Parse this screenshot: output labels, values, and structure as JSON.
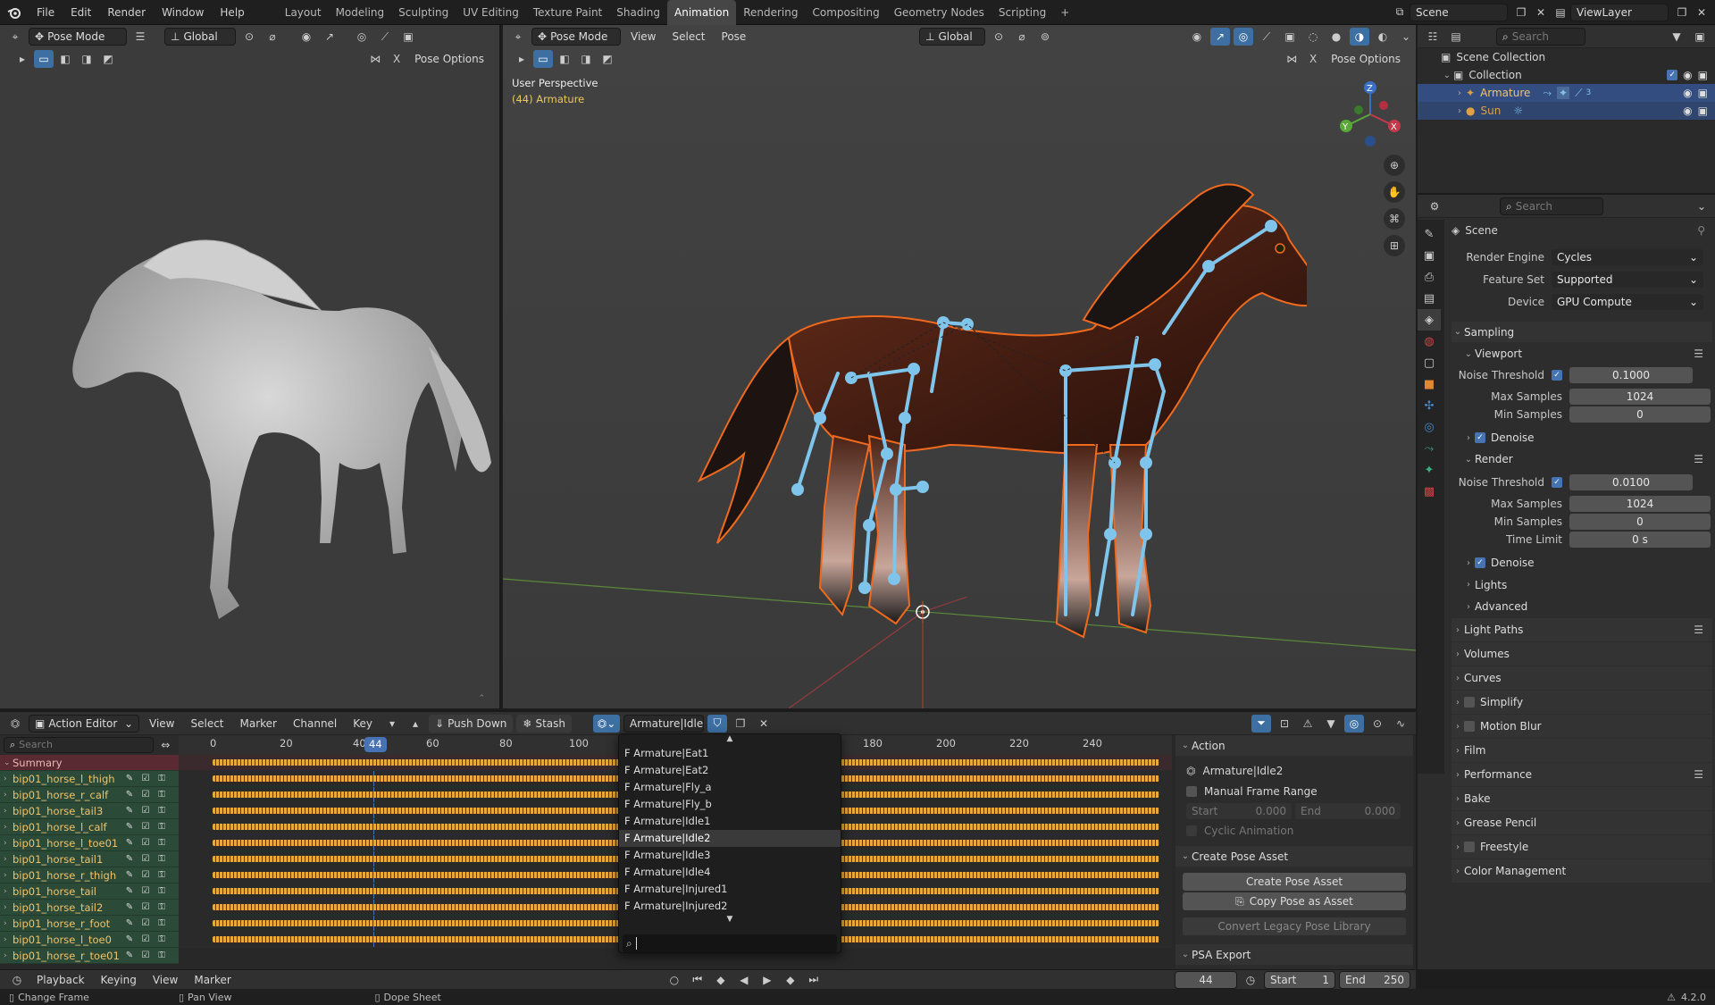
{
  "topbar": {
    "menus": [
      "File",
      "Edit",
      "Render",
      "Window",
      "Help"
    ],
    "workspaces": [
      "Layout",
      "Modeling",
      "Sculpting",
      "UV Editing",
      "Texture Paint",
      "Shading",
      "Animation",
      "Rendering",
      "Compositing",
      "Geometry Nodes",
      "Scripting"
    ],
    "active_workspace": "Animation",
    "scene": "Scene",
    "view_layer": "ViewLayer"
  },
  "left_viewport": {
    "mode": "Pose Mode",
    "transform": "Global",
    "pose_options": "Pose Options"
  },
  "main_viewport": {
    "mode": "Pose Mode",
    "menus": [
      "View",
      "Select",
      "Pose"
    ],
    "transform": "Global",
    "pose_options": "Pose Options",
    "overlay_title": "User Perspective",
    "overlay_object": "(44) Armature",
    "gizmo": {
      "z": "Z",
      "y": "Y",
      "x": "X"
    }
  },
  "outliner": {
    "search_placeholder": "Search",
    "items": [
      {
        "label": "Scene Collection"
      },
      {
        "label": "Collection"
      },
      {
        "label": "Armature",
        "extra": "3"
      },
      {
        "label": "Sun"
      }
    ]
  },
  "properties": {
    "search_placeholder": "Search",
    "title": "Scene",
    "render_engine_label": "Render Engine",
    "render_engine": "Cycles",
    "feature_set_label": "Feature Set",
    "feature_set": "Supported",
    "device_label": "Device",
    "device": "GPU Compute",
    "sampling": "Sampling",
    "viewport": "Viewport",
    "noise_threshold_label": "Noise Threshold",
    "viewport_noise_threshold": "0.1000",
    "max_samples_label": "Max Samples",
    "viewport_max_samples": "1024",
    "min_samples_label": "Min Samples",
    "viewport_min_samples": "0",
    "denoise": "Denoise",
    "render": "Render",
    "render_noise_threshold": "0.0100",
    "render_max_samples": "1024",
    "render_min_samples": "0",
    "time_limit_label": "Time Limit",
    "time_limit": "0 s",
    "lights": "Lights",
    "advanced": "Advanced",
    "sections": [
      "Light Paths",
      "Volumes",
      "Curves",
      "Simplify",
      "Motion Blur",
      "Film",
      "Performance",
      "Bake",
      "Grease Pencil",
      "Freestyle",
      "Color Management"
    ]
  },
  "action_editor": {
    "mode": "Action Editor",
    "menus": [
      "View",
      "Select",
      "Marker",
      "Channel",
      "Key"
    ],
    "push_down": "Push Down",
    "stash": "Stash",
    "action_name": "Armature|Idle2",
    "search_placeholder": "Search",
    "summary": "Summary",
    "current_frame": "44",
    "ticks_left": [
      "0",
      "20",
      "40",
      "60",
      "80",
      "100"
    ],
    "ticks_right": [
      "180",
      "200",
      "220",
      "240"
    ],
    "channels": [
      "bip01_horse_l_thigh",
      "bip01_horse_r_calf",
      "bip01_horse_tail3",
      "bip01_horse_l_calf",
      "bip01_horse_l_toe01",
      "bip01_horse_tail1",
      "bip01_horse_r_thigh",
      "bip01_horse_tail",
      "bip01_horse_tail2",
      "bip01_horse_r_foot",
      "bip01_horse_l_toe0",
      "bip01_horse_r_toe01"
    ],
    "dropdown_items": [
      "Armature|Eat1",
      "Armature|Eat2",
      "Armature|Fly_a",
      "Armature|Fly_b",
      "Armature|Idle1",
      "Armature|Idle2",
      "Armature|Idle3",
      "Armature|Idle4",
      "Armature|Injured1",
      "Armature|Injured2"
    ],
    "dropdown_selected": "Armature|Idle2"
  },
  "sidebar": {
    "action_header": "Action",
    "action_name": "Armature|Idle2",
    "manual_frame_range": "Manual Frame Range",
    "start_label": "Start",
    "start_value": "0.000",
    "end_label": "End",
    "end_value": "0.000",
    "cyclic": "Cyclic Animation",
    "create_pose_header": "Create Pose Asset",
    "create_pose_btn": "Create Pose Asset",
    "copy_pose_btn": "Copy Pose as Asset",
    "convert_btn": "Convert Legacy Pose Library",
    "psa_export": "PSA Export"
  },
  "timeline": {
    "menus": [
      "Playback",
      "Keying",
      "View",
      "Marker"
    ],
    "frame": "44",
    "start_label": "Start",
    "start": "1",
    "end_label": "End",
    "end": "250"
  },
  "statusbar": {
    "items": [
      "Change Frame",
      "Pan View",
      "Dope Sheet"
    ],
    "version": "4.2.0"
  },
  "colors": {
    "accent": "#4772b3",
    "bone": "#7fc4ea",
    "selection_outline": "#f06a1e",
    "keyframe": "#e8a83b"
  }
}
